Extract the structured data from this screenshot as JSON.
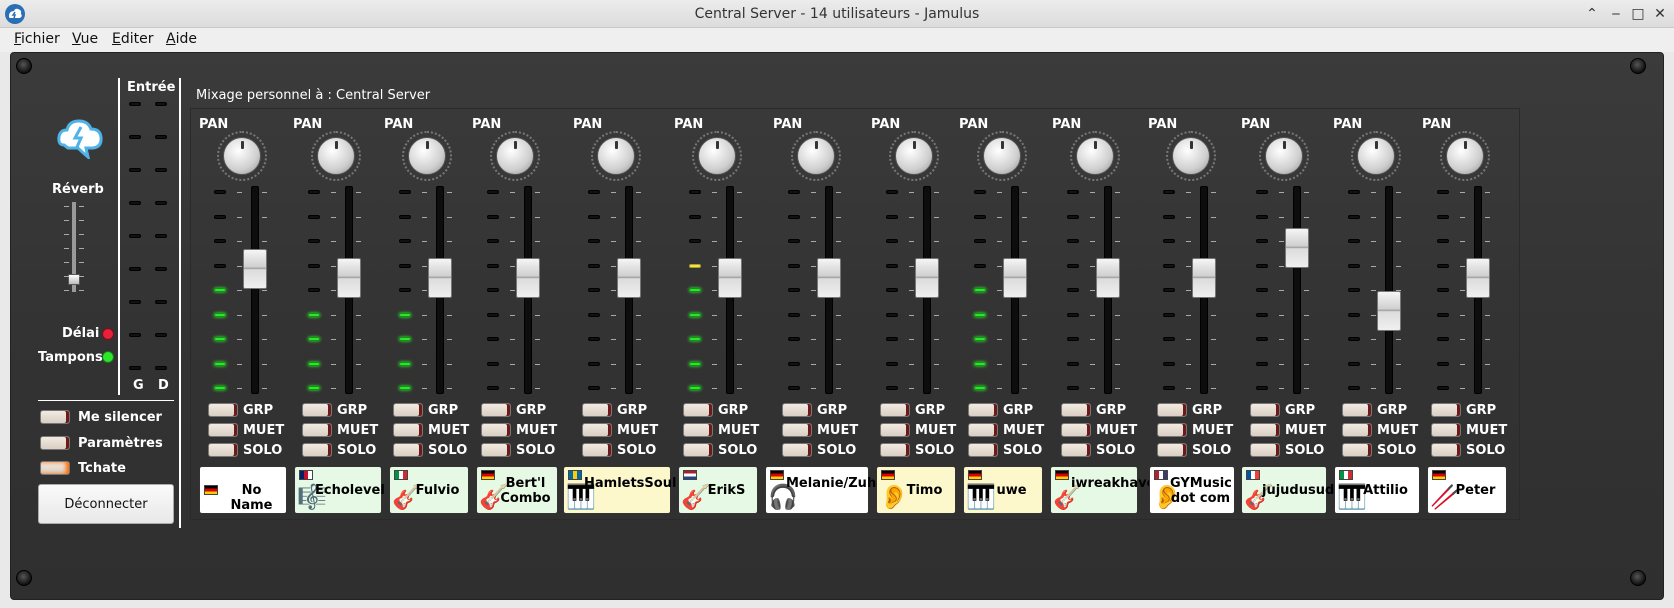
{
  "window": {
    "title": "Central Server - 14 utilisateurs - Jamulus"
  },
  "menu": [
    {
      "label": "Fichier",
      "accel": "F",
      "rest": "ichier"
    },
    {
      "label": "Vue",
      "accel": "V",
      "rest": "ue"
    },
    {
      "label": "Editer",
      "accel": "E",
      "rest": "diter"
    },
    {
      "label": "Aide",
      "accel": "A",
      "rest": "ide"
    }
  ],
  "left": {
    "input_label": "Entrée",
    "reverb_label": "Réverb",
    "reverb_level": 0.1,
    "delay_label": "Délai",
    "buffers_label": "Tampons",
    "left_label": "G",
    "right_label": "D",
    "mute_self": "Me silencer",
    "settings": "Paramètres",
    "chat": "Tchate",
    "disconnect": "Déconnecter",
    "colors": {
      "delay": "#e8213b",
      "buffers": "#2ee52e"
    }
  },
  "mix": {
    "title": "Mixage personnel à : Central Server"
  },
  "strip_labels": {
    "pan": "PAN",
    "grp": "GRP",
    "mute": "MUET",
    "solo": "SOLO"
  },
  "channels": [
    {
      "name": "No Name",
      "flag": "de",
      "instrument": "",
      "color": "white",
      "level": 5,
      "fader": 0.6
    },
    {
      "name": "Echolevel",
      "flag": "gb",
      "instrument": "conductor-icon",
      "color": "green",
      "level": 4,
      "fader": 0.56
    },
    {
      "name": "Fulvio",
      "flag": "it",
      "instrument": "guitar-icon",
      "color": "green",
      "level": 4,
      "fader": 0.56
    },
    {
      "name": "Bert'l Combo",
      "flag": "de",
      "instrument": "guitar-icon",
      "color": "green",
      "level": 0,
      "fader": 0.56
    },
    {
      "name": "HamletsSoul",
      "flag": "se",
      "instrument": "keyboard-icon",
      "color": "yellow",
      "level": 0,
      "fader": 0.56
    },
    {
      "name": "ErikS",
      "flag": "nl",
      "instrument": "guitar-icon",
      "color": "green",
      "level": 6,
      "fader": 0.56
    },
    {
      "name": "Melanie/Zuhörer",
      "flag": "de",
      "instrument": "listener-icon",
      "color": "white",
      "level": 0,
      "fader": 0.56
    },
    {
      "name": "Timo",
      "flag": "de",
      "instrument": "ear-icon",
      "color": "yellow",
      "level": 0,
      "fader": 0.56
    },
    {
      "name": "uwe",
      "flag": "de",
      "instrument": "keyboard-icon",
      "color": "yellow",
      "level": 5,
      "fader": 0.56
    },
    {
      "name": "iwreakhavoc",
      "flag": "de",
      "instrument": "guitar-icon",
      "color": "green",
      "level": 0,
      "fader": 0.56
    },
    {
      "name": "GYMusic dot com",
      "flag": "us",
      "instrument": "ear-icon",
      "color": "white",
      "level": 0,
      "fader": 0.56
    },
    {
      "name": "jujudusud",
      "flag": "fr",
      "instrument": "guitar-icon",
      "color": "green",
      "level": 0,
      "fader": 0.7
    },
    {
      "name": "Attilio",
      "flag": "it",
      "instrument": "keyboard-icon",
      "color": "white",
      "level": 0,
      "fader": 0.4
    },
    {
      "name": "Peter",
      "flag": "de",
      "instrument": "drumstick-icon",
      "color": "white",
      "level": 0,
      "fader": 0.56
    }
  ]
}
